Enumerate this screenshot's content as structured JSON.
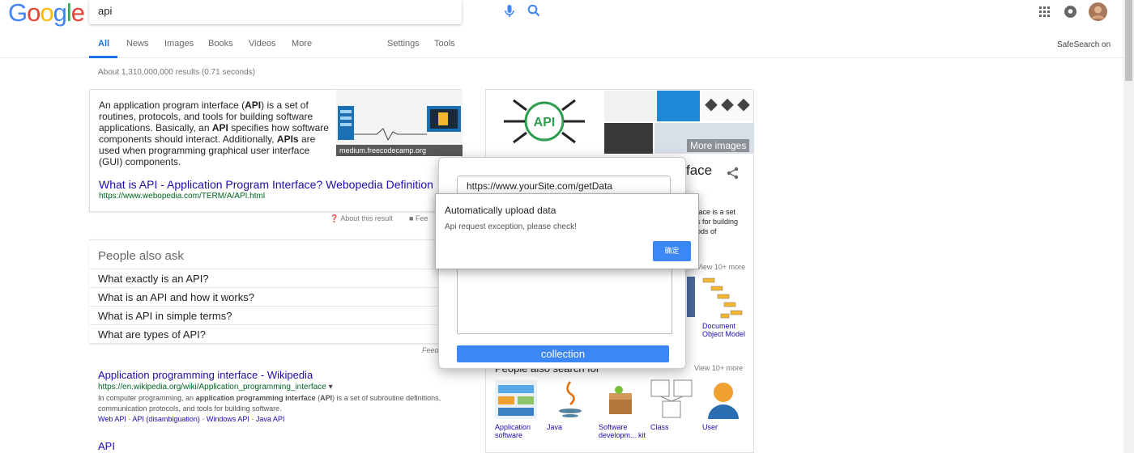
{
  "logo": [
    "G",
    "o",
    "o",
    "g",
    "l",
    "e"
  ],
  "logo_colors": [
    "#4285F4",
    "#EA4335",
    "#FBBC05",
    "#4285F4",
    "#34A853",
    "#EA4335"
  ],
  "search": {
    "query": "api"
  },
  "tabs": [
    "All",
    "News",
    "Images",
    "Books",
    "Videos",
    "More",
    "Settings",
    "Tools"
  ],
  "safesearch": "SafeSearch on",
  "stats": "About 1,310,000,000 results (0.71 seconds)",
  "snippet": {
    "text_parts": [
      "An application program interface (",
      "API",
      ") is a set of routines, protocols, and tools for building software applications. Basically, an ",
      "API",
      " specifies how software components should interact. Additionally, ",
      "APIs",
      " are used when programming graphical user interface (GUI) components."
    ],
    "image_caption": "medium.freecodecamp.org",
    "title": "What is API - Application Program Interface? Webopedia Definition",
    "url": "https://www.webopedia.com/TERM/A/API.html"
  },
  "about_result": "About this result",
  "feedback_partial": "Fee",
  "paa": {
    "heading": "People also ask",
    "questions": [
      "What exactly is an API?",
      "What is an API and how it works?",
      "What is API in simple terms?",
      "What are types of API?"
    ],
    "feedback": "Feed"
  },
  "result1": {
    "title": "Application programming interface - Wikipedia",
    "url": "https://en.wikipedia.org/wiki/Application_programming_interface",
    "desc_parts": [
      "In computer programming, an ",
      "application programming interface",
      " (",
      "API",
      ") is a set of subroutine definitions, communication protocols, and tools for building software."
    ],
    "links": "Web API · API (disambiguation) · Windows API · Java API"
  },
  "result2": {
    "title": "API"
  },
  "knowledge_panel": {
    "api_badge": "API",
    "more_images": "More images",
    "title_partial": "face",
    "snip_lines": [
      "face is a set",
      "s for building",
      "ods of"
    ],
    "view_more_1": "View 10+ more",
    "dom_label": "Document Object Model",
    "people_search_partial": "People also search for",
    "view_more_2": "View 10+ more",
    "items": [
      "Application software",
      "Java",
      "Software developm... kit",
      "Class",
      "User"
    ]
  },
  "modal_collect": {
    "url_value": "https://www.yourSite.com/getData",
    "button": "collection"
  },
  "modal_alert": {
    "title": "Automatically upload data",
    "message": "Api request exception, please check!",
    "ok": "确定"
  },
  "colors": {
    "accent": "#3b87f5",
    "link": "#1a0dab",
    "url_green": "#006621"
  }
}
